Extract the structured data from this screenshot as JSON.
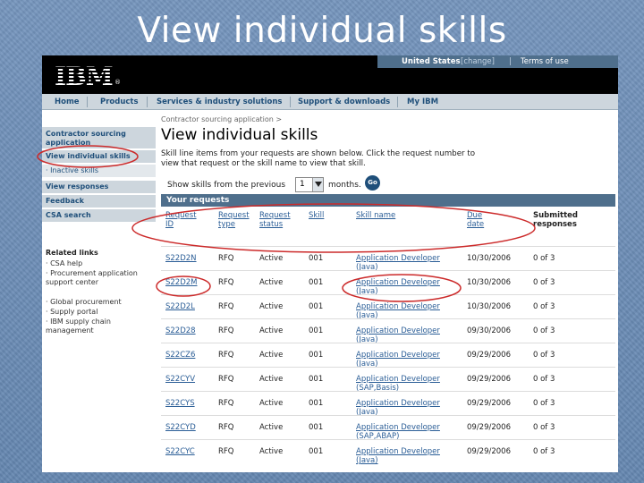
{
  "slide": {
    "title": "View individual skills"
  },
  "masthead": {
    "logo": "IBM",
    "links": [
      "United States",
      "[change]",
      "|",
      "Terms of use"
    ]
  },
  "nav": [
    "Home",
    "Products",
    "Services & industry solutions",
    "Support & downloads",
    "My IBM"
  ],
  "leftnav": {
    "section": "Contractor sourcing application",
    "items": [
      {
        "label": "View individual skills"
      },
      {
        "label": "· Inactive skills"
      },
      {
        "label": "View responses"
      },
      {
        "label": "Feedback"
      },
      {
        "label": "CSA search"
      }
    ],
    "related_title": "Related links",
    "related": [
      "· CSA help",
      "· Procurement application support center",
      "· Global procurement",
      "· Supply portal",
      "· IBM supply chain management"
    ]
  },
  "main": {
    "breadcrumb": "Contractor sourcing application  >",
    "title": "View individual skills",
    "intro": "Skill line items from your requests are shown below. Click the request number to view that request or the skill name to view that skill.",
    "show_label": "Show skills from the previous",
    "months_value": "1",
    "months_label": "months.",
    "go_label": "Go",
    "section_title": "Your requests",
    "columns": [
      "Request ID",
      "Request type",
      "Request status",
      "Skill",
      "Skill name",
      "Due date",
      "Submitted responses"
    ],
    "rows": [
      {
        "id": "S22D2N",
        "type": "RFQ",
        "status": "Active",
        "skill": "001",
        "name1": "Application Developer",
        "name2": "(Java)",
        "due": "10/30/2006",
        "resp": "0 of 3"
      },
      {
        "id": "S22D2M",
        "type": "RFQ",
        "status": "Active",
        "skill": "001",
        "name1": "Application Developer",
        "name2": "(Java)",
        "due": "10/30/2006",
        "resp": "0 of 3"
      },
      {
        "id": "S22D2L",
        "type": "RFQ",
        "status": "Active",
        "skill": "001",
        "name1": "Application Developer",
        "name2": "(Java)",
        "due": "10/30/2006",
        "resp": "0 of 3"
      },
      {
        "id": "S22D28",
        "type": "RFQ",
        "status": "Active",
        "skill": "001",
        "name1": "Application Developer",
        "name2": "(Java)",
        "due": "09/30/2006",
        "resp": "0 of 3"
      },
      {
        "id": "S22CZ6",
        "type": "RFQ",
        "status": "Active",
        "skill": "001",
        "name1": "Application Developer",
        "name2": "(Java)",
        "due": "09/29/2006",
        "resp": "0 of 3"
      },
      {
        "id": "S22CYV",
        "type": "RFQ",
        "status": "Active",
        "skill": "001",
        "name1": "Application Developer",
        "name2": "(SAP,Basis)",
        "due": "09/29/2006",
        "resp": "0 of 3"
      },
      {
        "id": "S22CYS",
        "type": "RFQ",
        "status": "Active",
        "skill": "001",
        "name1": "Application Developer",
        "name2": "(Java)",
        "due": "09/29/2006",
        "resp": "0 of 3"
      },
      {
        "id": "S22CYD",
        "type": "RFQ",
        "status": "Active",
        "skill": "001",
        "name1": "Application Developer",
        "name2": "(SAP,ABAP)",
        "due": "09/29/2006",
        "resp": "0 of 3"
      },
      {
        "id": "S22CYC",
        "type": "RFQ",
        "status": "Active",
        "skill": "001",
        "name1": "Application Developer",
        "name2": "(Java)",
        "due": "09/29/2006",
        "resp": "0 of 3"
      }
    ]
  },
  "colors": {
    "annotation": "#cc2a2a",
    "link": "#2a5d96",
    "bar": "#4f6f8c"
  }
}
